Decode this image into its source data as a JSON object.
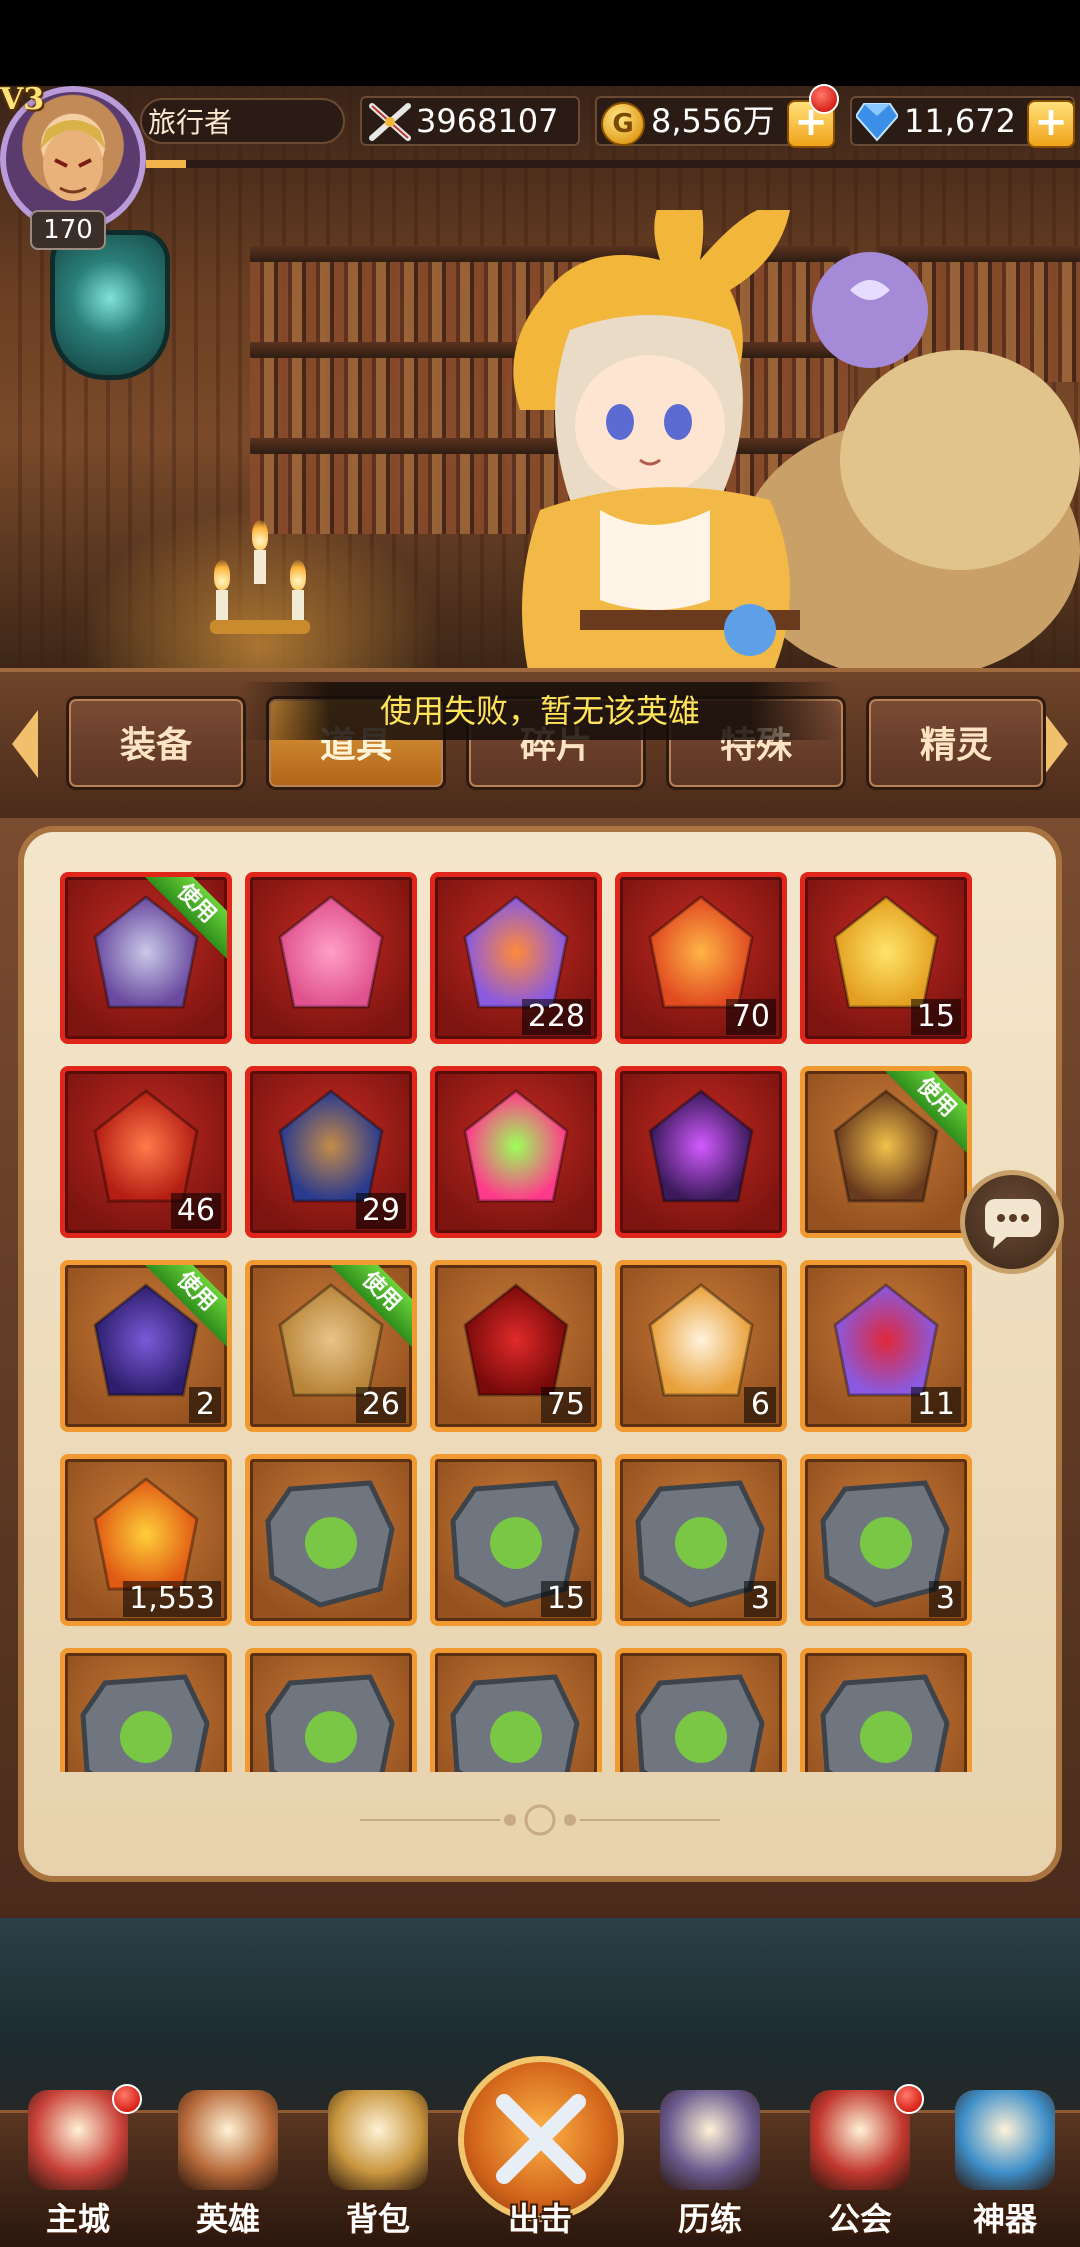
{
  "player": {
    "vip": "V3",
    "level": "170",
    "name": "旅行者",
    "power": "3968107",
    "gold": "8,556万",
    "gems": "11,672"
  },
  "toast": "使用失败，暂无该英雄",
  "tabs": [
    {
      "label": "装备",
      "active": false
    },
    {
      "label": "道具",
      "active": true
    },
    {
      "label": "碎片",
      "active": false
    },
    {
      "label": "特殊",
      "active": false
    },
    {
      "label": "精灵",
      "active": false
    }
  ],
  "use_badge": "使用",
  "inventory": [
    {
      "icon": "hero-card-icon",
      "count": "",
      "frame": "red",
      "use": true
    },
    {
      "icon": "pink-crystal-icon",
      "count": "",
      "frame": "red",
      "use": false
    },
    {
      "icon": "crystal-cluster-icon",
      "count": "228",
      "frame": "red",
      "use": false
    },
    {
      "icon": "fire-crystal-icon",
      "count": "70",
      "frame": "red",
      "use": false
    },
    {
      "icon": "gold-token-icon",
      "count": "15",
      "frame": "red",
      "use": false
    },
    {
      "icon": "red-gem-icon",
      "count": "46",
      "frame": "red",
      "use": false
    },
    {
      "icon": "spell-book-icon",
      "count": "29",
      "frame": "red",
      "use": false
    },
    {
      "icon": "rainbow-helmet-icon",
      "count": "",
      "frame": "red",
      "use": false
    },
    {
      "icon": "purple-helmet-icon",
      "count": "",
      "frame": "red",
      "use": false
    },
    {
      "icon": "treasure-chest-icon",
      "count": "",
      "frame": "orange",
      "use": true
    },
    {
      "icon": "mystery-bag-icon",
      "count": "2",
      "frame": "orange",
      "use": true
    },
    {
      "icon": "loot-bag-icon",
      "count": "26",
      "frame": "orange",
      "use": true
    },
    {
      "icon": "red-flower-icon",
      "count": "75",
      "frame": "orange",
      "use": false
    },
    {
      "icon": "potion-bottle-icon",
      "count": "6",
      "frame": "orange",
      "use": false
    },
    {
      "icon": "crystal-shards-icon",
      "count": "11",
      "frame": "orange",
      "use": false
    },
    {
      "icon": "fire-orb-icon",
      "count": "1,553",
      "frame": "orange",
      "use": false
    },
    {
      "icon": "rune-shield-icon",
      "count": "",
      "frame": "orange",
      "use": false
    },
    {
      "icon": "rune-figure-icon",
      "count": "15",
      "frame": "orange",
      "use": false
    },
    {
      "icon": "rune-sword-icon",
      "count": "3",
      "frame": "orange",
      "use": false
    },
    {
      "icon": "rune-book-icon",
      "count": "3",
      "frame": "orange",
      "use": false
    },
    {
      "icon": "rune-serpent-icon",
      "count": "",
      "frame": "orange",
      "use": false
    },
    {
      "icon": "rune-star-icon",
      "count": "",
      "frame": "orange",
      "use": false
    },
    {
      "icon": "rune-leaf-icon",
      "count": "",
      "frame": "orange",
      "use": false
    },
    {
      "icon": "rune-boot-icon",
      "count": "",
      "frame": "orange",
      "use": false
    },
    {
      "icon": "rune-blade-icon",
      "count": "",
      "frame": "orange",
      "use": false
    }
  ],
  "nav": [
    {
      "label": "主城",
      "badge": true,
      "color": "#c9423a"
    },
    {
      "label": "英雄",
      "badge": false,
      "color": "#b86a3a"
    },
    {
      "label": "背包",
      "badge": false,
      "color": "#c8963f"
    },
    {
      "label": "出击",
      "badge": false,
      "color": "#e07b22"
    },
    {
      "label": "历练",
      "badge": false,
      "color": "#6a5a8e"
    },
    {
      "label": "公会",
      "badge": true,
      "color": "#c2382f"
    },
    {
      "label": "神器",
      "badge": false,
      "color": "#3f8fc9"
    }
  ],
  "colors": {
    "red_frame": "#e0251b",
    "orange_frame": "#f19a32",
    "toast_text": "#ffe35a",
    "use_ribbon": "#4cb52b"
  }
}
